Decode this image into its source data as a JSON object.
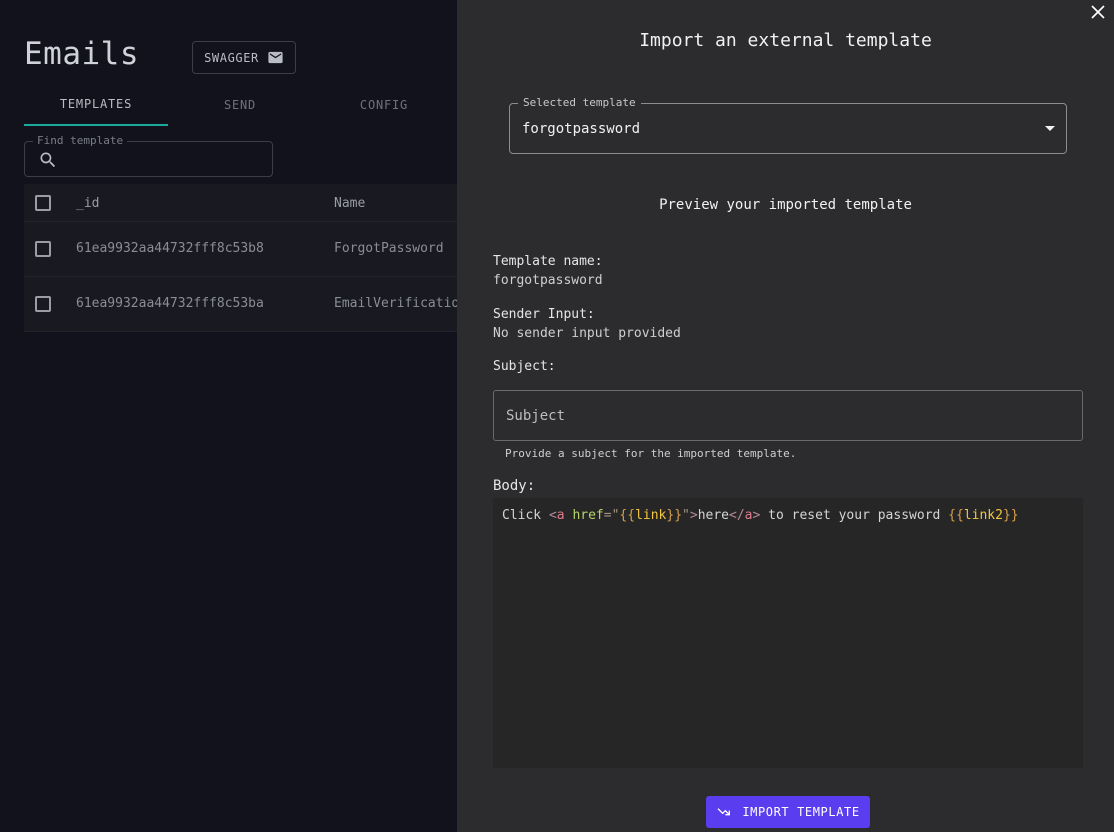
{
  "page": {
    "title": "Emails",
    "swagger_label": "SWAGGER",
    "tabs": [
      {
        "label": "TEMPLATES",
        "active": true
      },
      {
        "label": "SEND",
        "active": false
      },
      {
        "label": "CONFIG",
        "active": false
      }
    ],
    "find_label": "Find template",
    "table": {
      "columns": [
        "_id",
        "Name"
      ],
      "rows": [
        {
          "id": "61ea9932aa44732fff8c53b8",
          "name": "ForgotPassword"
        },
        {
          "id": "61ea9932aa44732fff8c53ba",
          "name": "EmailVerification"
        }
      ]
    }
  },
  "drawer": {
    "title": "Import an external template",
    "selected_template_label": "Selected template",
    "selected_template_value": "forgotpassword",
    "preview_title": "Preview your imported template",
    "template_name_label": "Template name:",
    "template_name_value": "forgotpassword",
    "sender_input_label": "Sender Input:",
    "sender_input_value": "No sender input provided",
    "subject_label": "Subject:",
    "subject_placeholder": "Subject",
    "subject_helper": "Provide a subject for the imported template.",
    "body_label": "Body:",
    "body_code": {
      "t1": "Click ",
      "t2": "<",
      "t3": "a",
      "t4": " ",
      "t5": "href",
      "t6": "=\"",
      "t7": "{{",
      "t8": "link",
      "t9": "}}",
      "t10": "\"",
      "t11": ">",
      "t12": "here",
      "t13": "</",
      "t14": "a",
      "t15": ">",
      "t16": " to reset your password ",
      "t17": "{{",
      "t18": "link2",
      "t19": "}}"
    },
    "import_button_label": "IMPORT TEMPLATE"
  },
  "icons": {
    "swagger": "mail-icon",
    "find": "search-icon",
    "close": "close-icon",
    "select": "arrow-drop-down-icon",
    "import": "trending-import-icon"
  },
  "colors": {
    "accent_tab": "#1aa99a",
    "import_button": "#5b3df0",
    "drawer_bg": "#2c2c2e",
    "page_bg": "#12121c"
  }
}
